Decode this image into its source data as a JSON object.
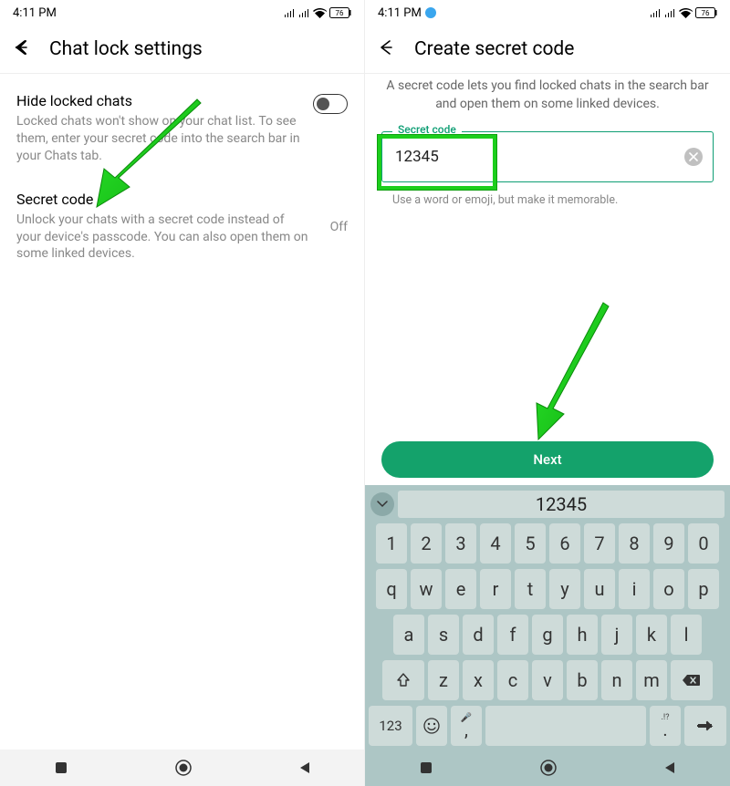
{
  "left": {
    "time": "4:11 PM",
    "battery": "76",
    "title": "Chat lock settings",
    "hide": {
      "title": "Hide locked chats",
      "desc": "Locked chats won't show on your chat list. To see them, enter your secret code into the search bar in your Chats tab."
    },
    "secret": {
      "title": "Secret code",
      "desc": "Unlock your chats with a secret code instead of your device's passcode. You can also open them on some linked devices.",
      "value": "Off"
    }
  },
  "right": {
    "time": "4:11 PM",
    "battery": "76",
    "title": "Create secret code",
    "desc": "A secret code lets you find locked chats in the search bar and open them on some linked devices.",
    "input": {
      "label": "Secret code",
      "value": "12345",
      "hint": "Use a word or emoji, but make it memorable."
    },
    "next": "Next"
  },
  "keyboard": {
    "suggest": "12345",
    "row0": [
      "1",
      "2",
      "3",
      "4",
      "5",
      "6",
      "7",
      "8",
      "9",
      "0"
    ],
    "row1": [
      "q",
      "w",
      "e",
      "r",
      "t",
      "y",
      "u",
      "i",
      "o",
      "p"
    ],
    "row2": [
      "a",
      "s",
      "d",
      "f",
      "g",
      "h",
      "j",
      "k",
      "l"
    ],
    "row3": [
      "z",
      "x",
      "c",
      "v",
      "b",
      "n",
      "m"
    ],
    "num": "123",
    "comma_top": "🎤",
    "comma_bot": ",",
    "period_top": ".!?",
    "period_bot": "."
  }
}
